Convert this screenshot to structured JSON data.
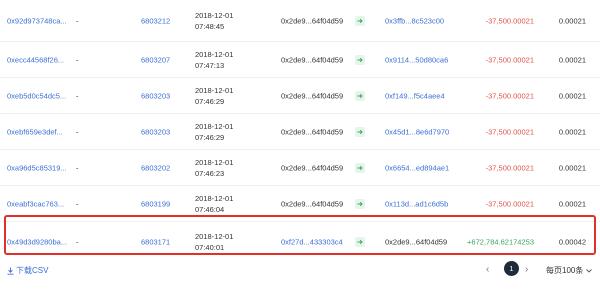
{
  "rows": [
    {
      "hash": "0x92d973748ca...",
      "method": "-",
      "block": "6803212",
      "date": "2018-12-01",
      "time": "07:48:45",
      "from": "0x2de9...64f04d59",
      "to": "0x3ffb...8c523c00",
      "value": "-37,500.00021",
      "fee": "0.00021"
    },
    {
      "hash": "0xecc44568f26...",
      "method": "-",
      "block": "6803207",
      "date": "2018-12-01",
      "time": "07:47:13",
      "from": "0x2de9...64f04d59",
      "to": "0x9114...50d80ca6",
      "value": "-37,500.00021",
      "fee": "0.00021"
    },
    {
      "hash": "0xeb5d0c54dc5...",
      "method": "-",
      "block": "6803203",
      "date": "2018-12-01",
      "time": "07:46:29",
      "from": "0x2de9...64f04d59",
      "to": "0xf149...f5c4aee4",
      "value": "-37,500.00021",
      "fee": "0.00021"
    },
    {
      "hash": "0xebf659e3def...",
      "method": "-",
      "block": "6803203",
      "date": "2018-12-01",
      "time": "07:46:29",
      "from": "0x2de9...64f04d59",
      "to": "0x45d1...8e6d7970",
      "value": "-37,500.00021",
      "fee": "0.00021"
    },
    {
      "hash": "0xa96d5c85319...",
      "method": "-",
      "block": "6803202",
      "date": "2018-12-01",
      "time": "07:46:23",
      "from": "0x2de9...64f04d59",
      "to": "0x6654...ed894ae1",
      "value": "-37,500.00021",
      "fee": "0.00021"
    },
    {
      "hash": "0xeabf3cac763...",
      "method": "-",
      "block": "6803199",
      "date": "2018-12-01",
      "time": "07:46:04",
      "from": "0x2de9...64f04d59",
      "to": "0x113d...ad1c6d5b",
      "value": "-37,500.00021",
      "fee": "0.00021"
    },
    {
      "hash": "0x49d3d9280ba...",
      "method": "-",
      "block": "6803171",
      "date": "2018-12-01",
      "time": "07:40:01",
      "from": "0xf27d...433303c4",
      "to": "0x2de9...64f04d59",
      "value": "+672,784.62174253",
      "fee": "0.00042"
    }
  ],
  "footer": {
    "csv_label": "下载CSV",
    "prev": "‹",
    "current_page": "1",
    "next": "›",
    "per_page": "每页100条"
  },
  "colors": {
    "link": "#3b6fd4",
    "negative": "#e0534a",
    "positive": "#3aa55b",
    "highlight_border": "#e0302a"
  },
  "icons": {
    "direction": "arrow-right-icon",
    "download": "download-icon",
    "dropdown": "chevron-down-icon"
  }
}
